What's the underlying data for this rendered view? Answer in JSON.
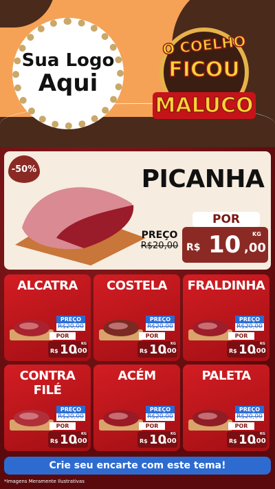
{
  "header": {
    "logo": {
      "line1": "Sua Logo",
      "line2": "Aqui"
    },
    "brand": {
      "line1": "O COELHO",
      "line2": "FICOU",
      "line3": "MALUCO"
    }
  },
  "featured": {
    "discount": "-50%",
    "name": "PICANHA",
    "price_label": "PREÇO",
    "old_price": "R$20,00",
    "por_label": "POR",
    "currency": "R$",
    "price_int": "10",
    "price_dec": ",00",
    "unit": "KG"
  },
  "cards": [
    {
      "name": "ALCATRA",
      "price_label": "PREÇO",
      "old_price": "R$20,00",
      "por_label": "POR",
      "currency": "R$",
      "price_int": "10",
      "price_dec": ",00",
      "unit": "KG"
    },
    {
      "name": "COSTELA",
      "price_label": "PREÇO",
      "old_price": "R$20,00",
      "por_label": "POR",
      "currency": "R$",
      "price_int": "10",
      "price_dec": ",00",
      "unit": "KG"
    },
    {
      "name": "FRALDINHA",
      "price_label": "PREÇO",
      "old_price": "R$20,00",
      "por_label": "POR",
      "currency": "R$",
      "price_int": "10",
      "price_dec": ",00",
      "unit": "KG"
    },
    {
      "name": "CONTRA FILÉ",
      "price_label": "PREÇO",
      "old_price": "R$20,00",
      "por_label": "POR",
      "currency": "R$",
      "price_int": "10",
      "price_dec": ",00",
      "unit": "KG"
    },
    {
      "name": "ACÉM",
      "price_label": "PREÇO",
      "old_price": "R$20,00",
      "por_label": "POR",
      "currency": "R$",
      "price_int": "10",
      "price_dec": ",00",
      "unit": "KG"
    },
    {
      "name": "PALETA",
      "price_label": "PREÇO",
      "old_price": "R$20,00",
      "por_label": "POR",
      "currency": "R$",
      "price_int": "10",
      "price_dec": ",00",
      "unit": "KG"
    }
  ],
  "cta": "Crie seu encarte com este tema!",
  "footnote": "*Imagens Meramente Ilustrativas",
  "colors": {
    "accent": "#c4161c",
    "cta": "#2e6bd0",
    "header_bg": "#f5a256",
    "dark_brown": "#4a2a1b"
  }
}
